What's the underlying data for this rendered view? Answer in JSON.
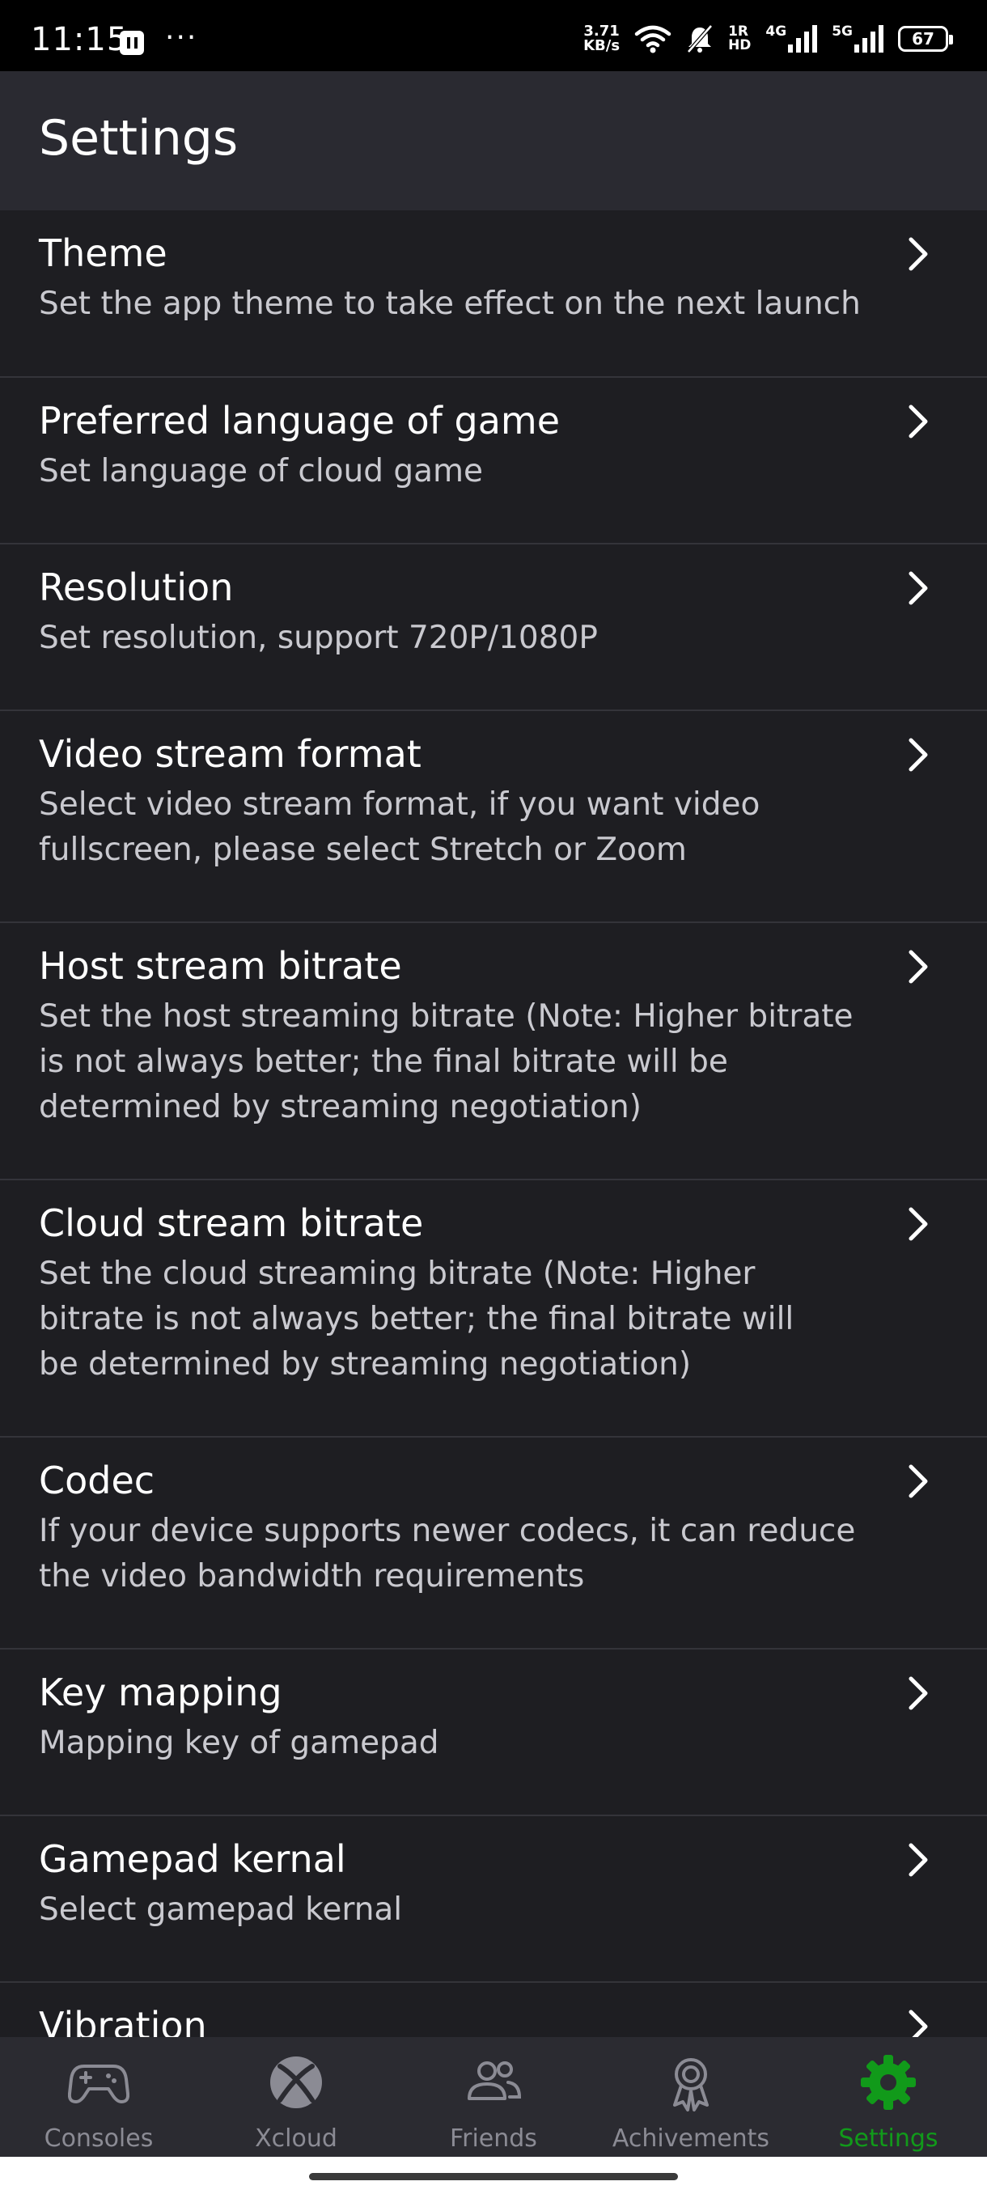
{
  "status_bar": {
    "time": "11:15",
    "dots": "···",
    "speed_value": "3.71",
    "speed_unit": "KB/s",
    "hd_top": "1R",
    "hd_bottom": "HD",
    "net1": "4G",
    "net2": "5G",
    "battery": "67"
  },
  "header": {
    "title": "Settings"
  },
  "settings": [
    {
      "title": "Theme",
      "description": "Set the app theme to take effect on the next launch"
    },
    {
      "title": "Preferred language of game",
      "description": "Set language of cloud game"
    },
    {
      "title": "Resolution",
      "description": "Set resolution, support 720P/1080P"
    },
    {
      "title": "Video stream format",
      "description": "Select video stream format, if you want video fullscreen, please select Stretch or Zoom"
    },
    {
      "title": "Host stream bitrate",
      "description": "Set the host streaming bitrate (Note: Higher bitrate is not always better; the final bitrate will be determined by streaming negotiation)"
    },
    {
      "title": "Cloud stream bitrate",
      "description": "Set the cloud streaming bitrate (Note: Higher bitrate is not always better; the final bitrate will be determined by streaming negotiation)"
    },
    {
      "title": "Codec",
      "description": "If your device supports newer codecs, it can reduce the video bandwidth requirements"
    },
    {
      "title": "Key mapping",
      "description": "Mapping key of gamepad"
    },
    {
      "title": "Gamepad kernal",
      "description": "Select gamepad kernal"
    },
    {
      "title": "Vibration",
      "description": ""
    }
  ],
  "bottom_nav": [
    {
      "label": "Consoles",
      "icon": "gamepad-icon",
      "active": false
    },
    {
      "label": "Xcloud",
      "icon": "xbox-icon",
      "active": false
    },
    {
      "label": "Friends",
      "icon": "friends-icon",
      "active": false
    },
    {
      "label": "Achivements",
      "icon": "achievement-ribbon-icon",
      "active": false
    },
    {
      "label": "Settings",
      "icon": "gear-icon",
      "active": true
    }
  ],
  "colors": {
    "background": "#1e1e22",
    "header": "#2a2a31",
    "nav": "#2b2b31",
    "accent": "#119a1a",
    "inactive": "#8b8b94"
  }
}
